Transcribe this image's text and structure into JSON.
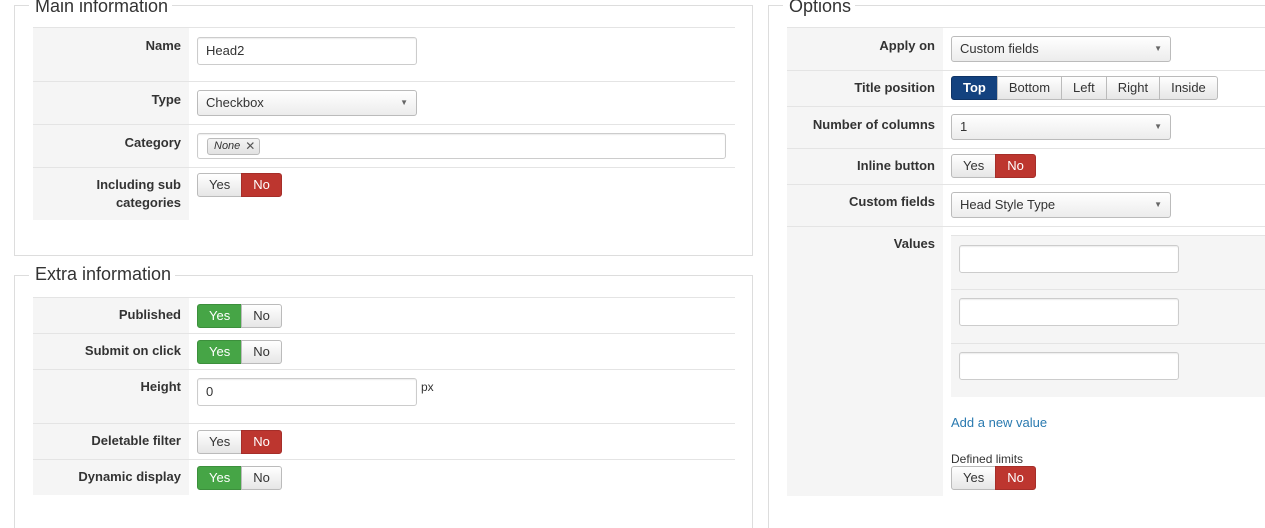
{
  "main_info": {
    "legend": "Main information",
    "name_label": "Name",
    "name_value": "Head2",
    "type_label": "Type",
    "type_value": "Checkbox",
    "category_label": "Category",
    "category_tag": "None",
    "category_tag_remove": "✕",
    "including_sub_label": "Including sub categories",
    "including_sub": {
      "yes": "Yes",
      "no": "No",
      "selected": "No"
    }
  },
  "extra_info": {
    "legend": "Extra information",
    "published": {
      "label": "Published",
      "yes": "Yes",
      "no": "No",
      "selected": "Yes"
    },
    "submit_on_click": {
      "label": "Submit on click",
      "yes": "Yes",
      "no": "No",
      "selected": "Yes"
    },
    "height": {
      "label": "Height",
      "value": "0",
      "unit": "px"
    },
    "deletable_filter": {
      "label": "Deletable filter",
      "yes": "Yes",
      "no": "No",
      "selected": "No"
    },
    "dynamic_display": {
      "label": "Dynamic display",
      "yes": "Yes",
      "no": "No",
      "selected": "Yes"
    }
  },
  "options": {
    "legend": "Options",
    "apply_on": {
      "label": "Apply on",
      "value": "Custom fields"
    },
    "title_position": {
      "label": "Title position",
      "choices": [
        "Top",
        "Bottom",
        "Left",
        "Right",
        "Inside"
      ],
      "selected": "Top"
    },
    "number_of_columns": {
      "label": "Number of columns",
      "value": "1"
    },
    "inline_button": {
      "label": "Inline button",
      "yes": "Yes",
      "no": "No",
      "selected": "No"
    },
    "custom_fields": {
      "label": "Custom fields",
      "value": "Head Style Type"
    },
    "values": {
      "label": "Values",
      "entries": [
        "",
        "",
        ""
      ]
    },
    "add_new_value": "Add a new value",
    "defined_limits": {
      "label": "Defined limits",
      "yes": "Yes",
      "no": "No",
      "selected": "No"
    }
  },
  "icons": {
    "dropdown": "chevron-down-icon",
    "remove": "close-icon"
  },
  "colors": {
    "yes_active": "#46a546",
    "no_active": "#bd362f",
    "position_active": "#13427f",
    "link": "#2a7ab0"
  }
}
